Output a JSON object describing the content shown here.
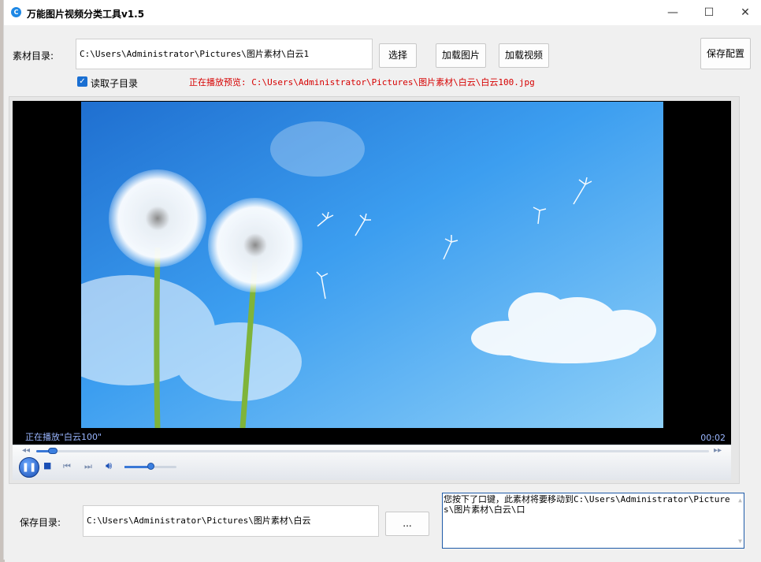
{
  "window": {
    "title": "万能图片视频分类工具v1.5",
    "app_icon": "C",
    "minimize": "—",
    "maximize": "☐",
    "close": "✕"
  },
  "source": {
    "label": "素材目录:",
    "path": "C:\\Users\\Administrator\\Pictures\\图片素材\\白云1",
    "choose_button": "选择",
    "load_images_button": "加载图片",
    "load_videos_button": "加载视频",
    "save_config_button": "保存配置"
  },
  "options": {
    "read_subdirs_label": "读取子目录",
    "read_subdirs_checked": true
  },
  "now_playing": "正在播放预览: C:\\Users\\Administrator\\Pictures\\图片素材\\白云\\白云100.jpg",
  "player": {
    "status": "正在播放\"白云100\"",
    "time": "00:02",
    "progress": 0.02,
    "volume": 0.5,
    "play_state_icon": "pause-icon"
  },
  "output": {
    "label": "保存目录:",
    "path": "C:\\Users\\Administrator\\Pictures\\图片素材\\白云",
    "browse_button": "...",
    "message": "您按下了口键，此素材将要移动到C:\\Users\\Administrator\\Pictures\\图片素材\\白云\\口"
  }
}
